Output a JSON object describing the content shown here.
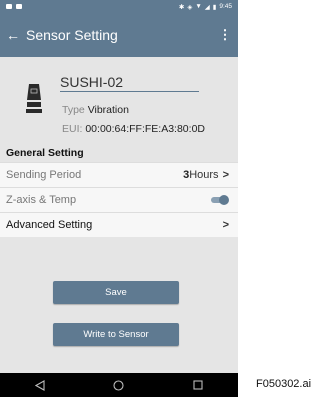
{
  "statusbar": {
    "time": "9:45"
  },
  "appbar": {
    "title": "Sensor Setting",
    "back_icon": "arrow-left-icon",
    "menu_icon": "more-vertical-icon"
  },
  "device": {
    "name": "SUSHI-02",
    "type_label": "Type",
    "type_value": "Vibration",
    "eui_label": "EUI:",
    "eui_value": "00:00:64:FF:FE:A3:80:0D",
    "icon": "sensor-device-icon"
  },
  "general": {
    "header": "General Setting",
    "sending_period": {
      "label": "Sending Period",
      "value_num": "3",
      "value_unit": "Hours"
    },
    "zaxis": {
      "label": "Z-axis & Temp",
      "enabled": true
    }
  },
  "advanced": {
    "label": "Advanced Setting"
  },
  "buttons": {
    "save": "Save",
    "write": "Write to Sensor"
  },
  "caption": "F050302.ai",
  "colors": {
    "primary": "#5f7a91",
    "background": "#e5e5e5",
    "navbar": "#000000"
  }
}
